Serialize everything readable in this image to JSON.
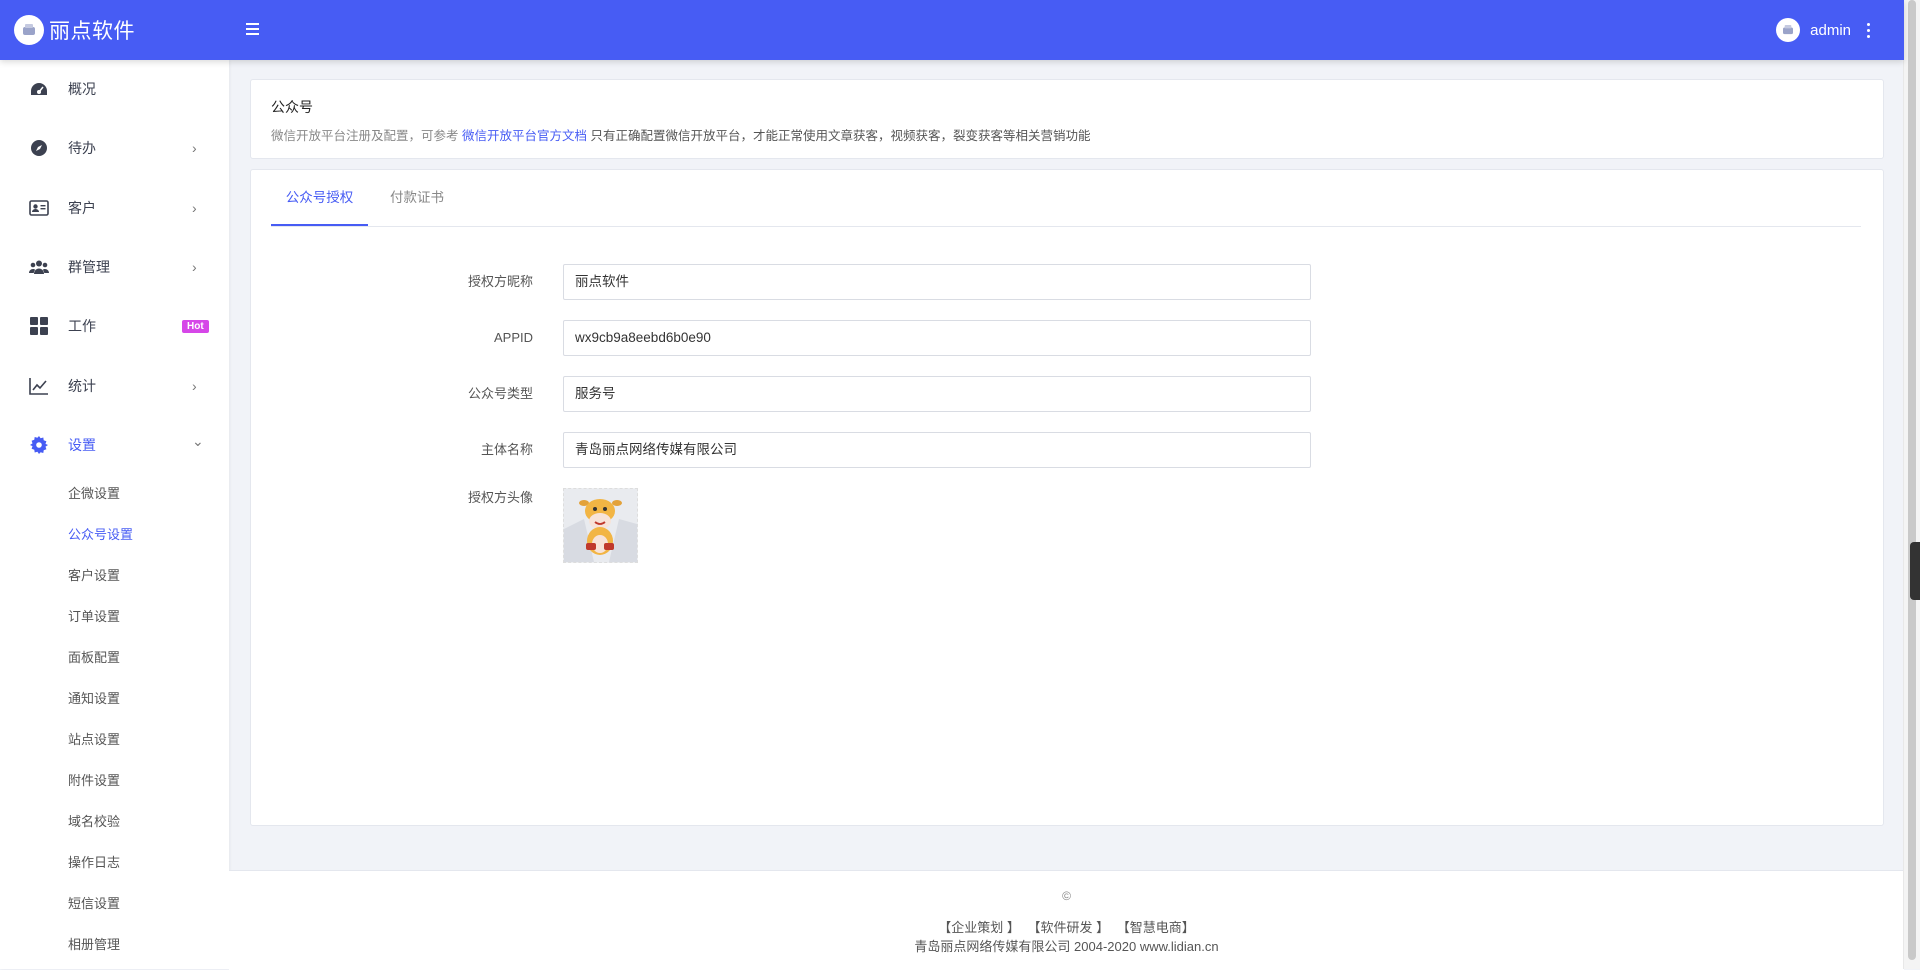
{
  "brand": {
    "name": "丽点软件"
  },
  "user": {
    "name": "admin"
  },
  "sidebar": {
    "items": [
      {
        "label": "概况",
        "icon": "dashboard-icon"
      },
      {
        "label": "待办",
        "icon": "compass-icon",
        "arrow": "›"
      },
      {
        "label": "客户",
        "icon": "id-card-icon",
        "arrow": "›"
      },
      {
        "label": "群管理",
        "icon": "users-icon",
        "arrow": "›"
      },
      {
        "label": "工作",
        "icon": "grid-icon",
        "badge": "Hot"
      },
      {
        "label": "统计",
        "icon": "line-chart-icon",
        "arrow": "›"
      },
      {
        "label": "设置",
        "icon": "gear-icon",
        "arrow": "⌄"
      }
    ],
    "sub_items": [
      "企微设置",
      "公众号设置",
      "客户设置",
      "订单设置",
      "面板配置",
      "通知设置",
      "站点设置",
      "附件设置",
      "域名校验",
      "操作日志",
      "短信设置",
      "相册管理"
    ],
    "active_color": "#475cf4"
  },
  "header_card": {
    "title": "公众号",
    "desc_prefix": "微信开放平台注册及配置，可参考",
    "desc_link": "微信开放平台官方文档",
    "desc_note": "只有正确配置微信开放平台，才能正常使用文章获客，视频获客，裂变获客等相关营销功能"
  },
  "tabs": [
    "公众号授权",
    "付款证书"
  ],
  "form": {
    "nickname_label": "授权方昵称",
    "nickname_value": "丽点软件",
    "appid_label": "APPID",
    "appid_value": "wx9cb9a8eebd6b0e90",
    "type_label": "公众号类型",
    "type_value": "服务号",
    "entity_label": "主体名称",
    "entity_value": "青岛丽点网络传媒有限公司",
    "avatar_label": "授权方头像"
  },
  "footer": {
    "copyright": "©",
    "link_1": "【企业策划 】",
    "link_2": "【软件研发 】",
    "link_3": "【智慧电商】",
    "company": "青岛丽点网络传媒有限公司 2004-2020 www.lidian.cn"
  },
  "colors": {
    "primary": "#475cf4",
    "hot_badge": "#d647e8"
  }
}
